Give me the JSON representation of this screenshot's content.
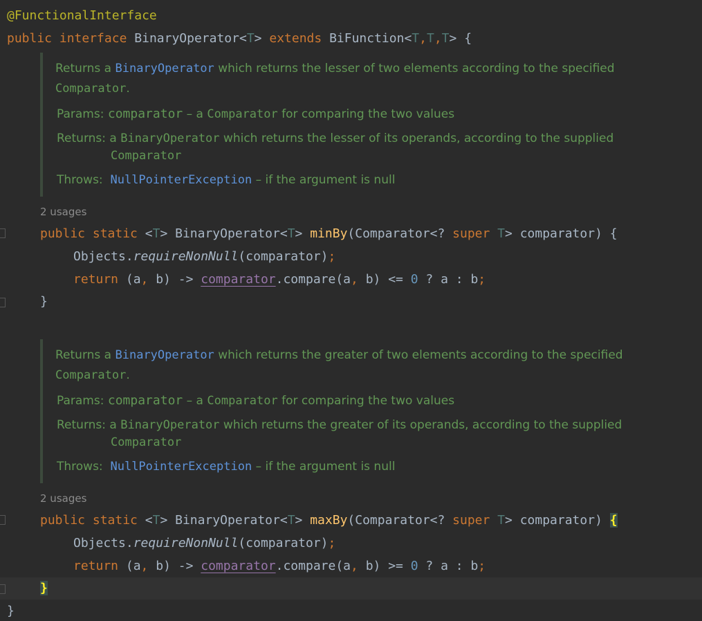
{
  "code": {
    "annotation": "@FunctionalInterface",
    "kw_public": "public",
    "kw_interface": "interface",
    "kw_static": "static",
    "kw_extends": "extends",
    "kw_super": "super",
    "kw_return": "return",
    "type_param": "T",
    "interface_name": "BinaryOperator",
    "bifunction": "BiFunction",
    "comparator_type": "Comparator",
    "objects": "Objects",
    "require_non_null": "requireNonNull",
    "param_name": "comparator",
    "compare_method": "compare",
    "zero": "0",
    "close_brace": "}",
    "open_brace": "{"
  },
  "methods": [
    {
      "name": "minBy",
      "operator": "<=",
      "usages": "2 usages",
      "doc": {
        "summary_before": "Returns a ",
        "summary_link": "BinaryOperator",
        "summary_after": " which returns the lesser of two elements according to the specified",
        "summary_line2": "Comparator",
        "summary_line2_end": ".",
        "params_label": "Params:",
        "params_name": "comparator",
        "params_dash": " – a ",
        "params_type": "Comparator",
        "params_desc": " for comparing the two values",
        "returns_label": "Returns:",
        "returns_a": "a ",
        "returns_type": "BinaryOperator",
        "returns_desc": " which returns the lesser of its operands, according to the supplied",
        "returns_line2": "Comparator",
        "throws_label": "Throws:",
        "throws_type": "NullPointerException",
        "throws_desc": " – if the argument is null"
      }
    },
    {
      "name": "maxBy",
      "operator": ">=",
      "usages": "2 usages",
      "doc": {
        "summary_before": "Returns a ",
        "summary_link": "BinaryOperator",
        "summary_after": " which returns the greater of two elements according to the specified",
        "summary_line2": "Comparator",
        "summary_line2_end": ".",
        "params_label": "Params:",
        "params_name": "comparator",
        "params_dash": " – a ",
        "params_type": "Comparator",
        "params_desc": " for comparing the two values",
        "returns_label": "Returns:",
        "returns_a": "a ",
        "returns_type": "BinaryOperator",
        "returns_desc": " which returns the greater of its operands, according to the supplied",
        "returns_line2": "Comparator",
        "throws_label": "Throws:",
        "throws_type": "NullPointerException",
        "throws_desc": " – if the argument is null"
      }
    }
  ],
  "theme": {
    "background": "#2b2b2b",
    "keyword": "#cc7832",
    "doc_text": "#629755",
    "doc_link": "#5e93d9",
    "method_name": "#ffc66d",
    "field": "#9876aa",
    "number": "#6897bb",
    "annotation": "#bbb529"
  }
}
